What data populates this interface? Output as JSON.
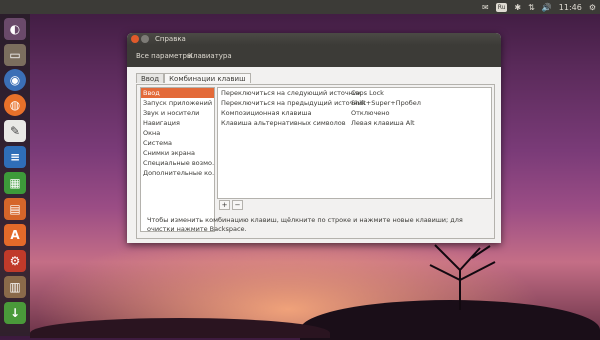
{
  "top_panel": {
    "keyboard_indicator": "Ru",
    "clock": "11:46"
  },
  "launcher": {
    "icons": [
      "dash-home-icon",
      "files-icon",
      "chromium-icon",
      "firefox-icon",
      "text-editor-icon",
      "writer-icon",
      "calc-icon",
      "impress-icon",
      "software-center-icon",
      "settings-icon",
      "system-monitor-icon",
      "download-icon"
    ]
  },
  "window": {
    "title": "Справка",
    "breadcrumbs": [
      "Все параметры",
      "Клавиатура"
    ],
    "tabs": [
      "Ввод",
      "Комбинации клавиш"
    ],
    "active_tab": 1,
    "categories": [
      "Ввод",
      "Запуск приложений",
      "Звук и носители",
      "Навигация",
      "Окна",
      "Система",
      "Снимки экрана",
      "Специальные возмо…",
      "Дополнительные ко…"
    ],
    "selected_category": 0,
    "shortcuts": [
      {
        "name": "Переключиться на следующий источник",
        "key": "Caps Lock"
      },
      {
        "name": "Переключиться на предыдущий источник",
        "key": "Shift+Super+Пробел"
      },
      {
        "name": "Композиционная клавиша",
        "key": "Отключено"
      },
      {
        "name": "Клавиша альтернативных символов",
        "key": "Левая клавиша Alt"
      }
    ],
    "add_label": "+",
    "remove_label": "−",
    "hint": "Чтобы изменить комбинацию клавиш, щёлкните по строке и нажмите новые клавиши; для очистки нажмите Backspace."
  },
  "colors": {
    "accent": "#e36a39",
    "panel_dark": "#3c3b37"
  }
}
